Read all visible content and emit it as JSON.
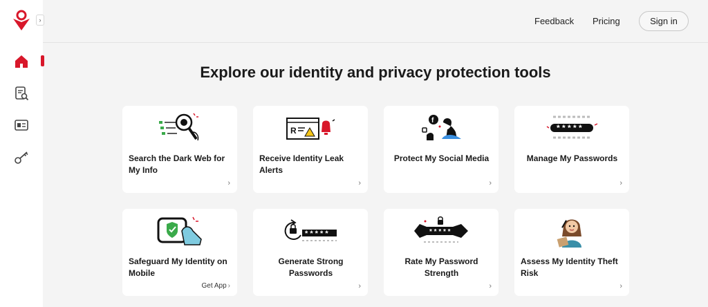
{
  "sidebar": {
    "collapse_glyph": "›",
    "items": [
      {
        "icon": "home-icon"
      },
      {
        "icon": "report-search-icon"
      },
      {
        "icon": "id-card-icon"
      },
      {
        "icon": "key-icon"
      }
    ]
  },
  "header": {
    "feedback_label": "Feedback",
    "pricing_label": "Pricing",
    "signin_label": "Sign in"
  },
  "main": {
    "title": "Explore our identity and privacy protection tools",
    "cards": [
      {
        "label": "Search the Dark Web for My Info",
        "icon": "dark-web-search-icon",
        "action": "›"
      },
      {
        "label": "Receive Identity Leak Alerts",
        "icon": "leak-alert-icon",
        "action": "›"
      },
      {
        "label": "Protect My Social Media",
        "icon": "social-media-icon",
        "action": "›"
      },
      {
        "label": "Manage My Passwords",
        "icon": "password-manager-icon",
        "action": "›"
      },
      {
        "label": "Safeguard My Identity on Mobile",
        "icon": "mobile-shield-icon",
        "action": "Get App",
        "action_glyph": "›"
      },
      {
        "label": "Generate Strong Passwords",
        "icon": "password-generator-icon",
        "action": "›"
      },
      {
        "label": "Rate My Password Strength",
        "icon": "password-strength-icon",
        "action": "›"
      },
      {
        "label": "Assess My Identity Theft Risk",
        "icon": "risk-assessment-icon",
        "action": "›"
      }
    ]
  },
  "colors": {
    "brand_red": "#d8172a",
    "background": "#f4f4f4",
    "card": "#ffffff"
  }
}
